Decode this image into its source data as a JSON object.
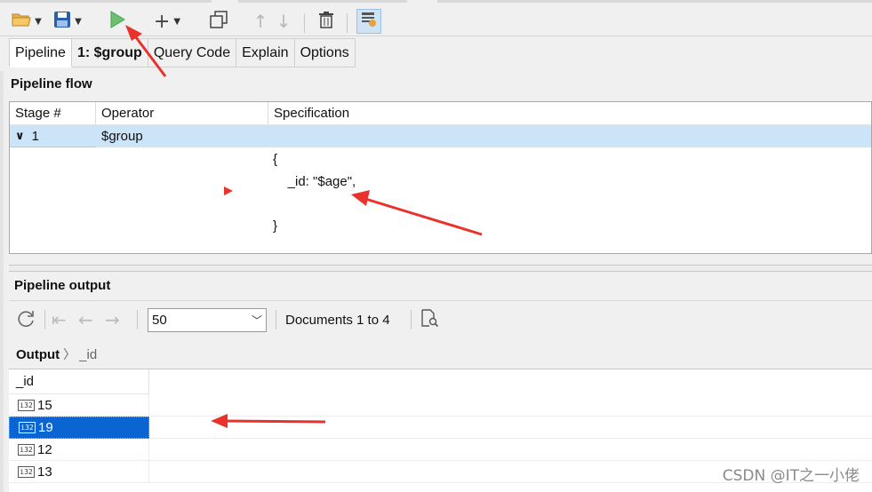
{
  "toolbar": {
    "icons": [
      "folder-open-icon",
      "save-icon",
      "run-icon",
      "add-icon",
      "copy-icon",
      "move-up-icon",
      "move-down-icon",
      "delete-icon",
      "settings-icon"
    ]
  },
  "tabs": [
    {
      "label": "Pipeline",
      "active": true
    },
    {
      "label": "1: $group",
      "bold": true
    },
    {
      "label": "Query Code"
    },
    {
      "label": "Explain"
    },
    {
      "label": "Options"
    }
  ],
  "flow": {
    "title": "Pipeline flow",
    "columns": [
      "Stage #",
      "Operator",
      "Specification"
    ],
    "row": {
      "expander": "∨",
      "stage": "1",
      "operator": "$group"
    },
    "spec_lines": [
      "{",
      "    _id: \"$age\",",
      "",
      "}"
    ]
  },
  "output": {
    "title": "Pipeline output",
    "page_size": "50",
    "documents_label": "Documents 1 to 4",
    "breadcrumb": {
      "root": "Output",
      "child": "_id"
    },
    "column": "_id",
    "rows": [
      "15",
      "19",
      "12",
      "13"
    ],
    "selected_index": 1,
    "num_icon": "int32-icon"
  },
  "watermark": "CSDN @IT之一小佬",
  "colors": {
    "selection": "#0a64d1",
    "row_highlight": "#cce4f7",
    "annotation": "#e8322b",
    "run_green": "#3aa655"
  }
}
